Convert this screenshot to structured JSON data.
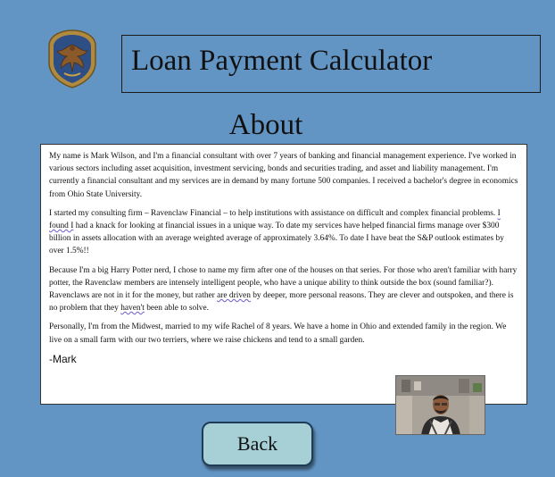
{
  "header": {
    "crest_icon": "ravenclaw-crest-icon",
    "title": "Loan Payment Calculator"
  },
  "about": {
    "heading": "About",
    "paragraphs": [
      {
        "text": "My name is Mark Wilson, and I'm a financial consultant with over 7 years of banking and financial management experience.  I've worked in various sectors including asset acquisition, investment servicing, bonds and securities trading, and asset and liability management.  I'm currently a financial consultant and my services are in demand by many fortune 500 companies.  I received a bachelor's degree in economics from Ohio State University."
      },
      {
        "before": "I started my consulting firm – Ravenclaw Financial – to help institutions with assistance on difficult and complex financial problems.  ",
        "flagged": "I found I",
        "after": " had a knack for looking at financial issues in a unique way.  To date my services have helped financial firms manage over $300 billion in assets allocation with an average weighted average of approximately 3.64%.  To date I have beat the S&P outlook estimates by over 1.5%!!"
      },
      {
        "before": "Because I'm a big Harry Potter nerd, I chose to name my firm after one of the houses on that series.  For those who aren't familiar with harry potter, the Ravenclaw members are intensely intelligent people, who have a unique ability to think outside the box (sound familiar?).  Ravenclaws are not in it for the money, but rather ",
        "flagged": "are driven",
        "middle": " by deeper, more personal reasons.  They are clever and outspoken, and there is no problem that they ",
        "flagged2": "haven't",
        "after": " been able to solve."
      },
      {
        "text": "Personally, I'm from the Midwest, married to my wife Rachel of 8 years.  We have a home in Ohio and extended family in the region.  We live on a small farm with our two terriers, where we raise chickens and tend to a small garden."
      }
    ],
    "signoff": "-Mark"
  },
  "back_button": {
    "label": "Back"
  },
  "colors": {
    "page_background": "#6395c4",
    "button_fill": "#a6cfd6",
    "button_border": "#1f3c57"
  }
}
